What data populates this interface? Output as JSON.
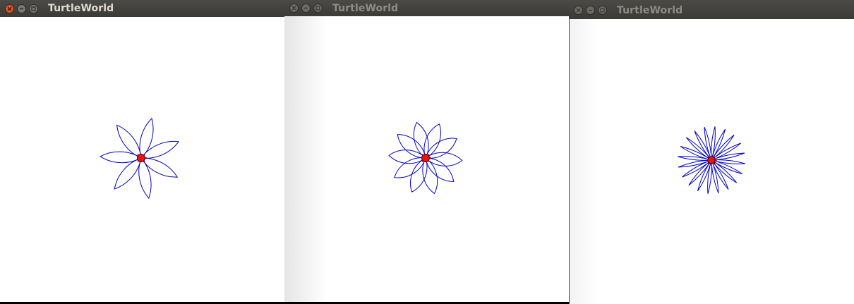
{
  "windows": [
    {
      "title": "TurtleWorld",
      "active": true,
      "close_color": "#e95420",
      "title_color": "#dfdbd2",
      "drawing": {
        "type": "flower",
        "petals": 7,
        "petal_angle_deg": 60
      }
    },
    {
      "title": "TurtleWorld",
      "active": false,
      "close_color": "#6d6b66",
      "title_color": "#8f8c85",
      "drawing": {
        "type": "flower",
        "petals": 10,
        "petal_angle_deg": 80
      }
    },
    {
      "title": "TurtleWorld",
      "active": false,
      "close_color": "#6d6b66",
      "title_color": "#8f8c85",
      "drawing": {
        "type": "flower",
        "petals": 20,
        "petal_angle_deg": 20
      }
    }
  ],
  "colors": {
    "pen": "#0000cc",
    "turtle": "#ee1111",
    "turtle_outline": "#550000",
    "titlebar": "#3c3b37",
    "canvas": "#ffffff"
  },
  "icons": {
    "close": "close-icon",
    "minimize": "minimize-icon",
    "maximize": "maximize-icon",
    "turtle": "turtle-icon"
  }
}
